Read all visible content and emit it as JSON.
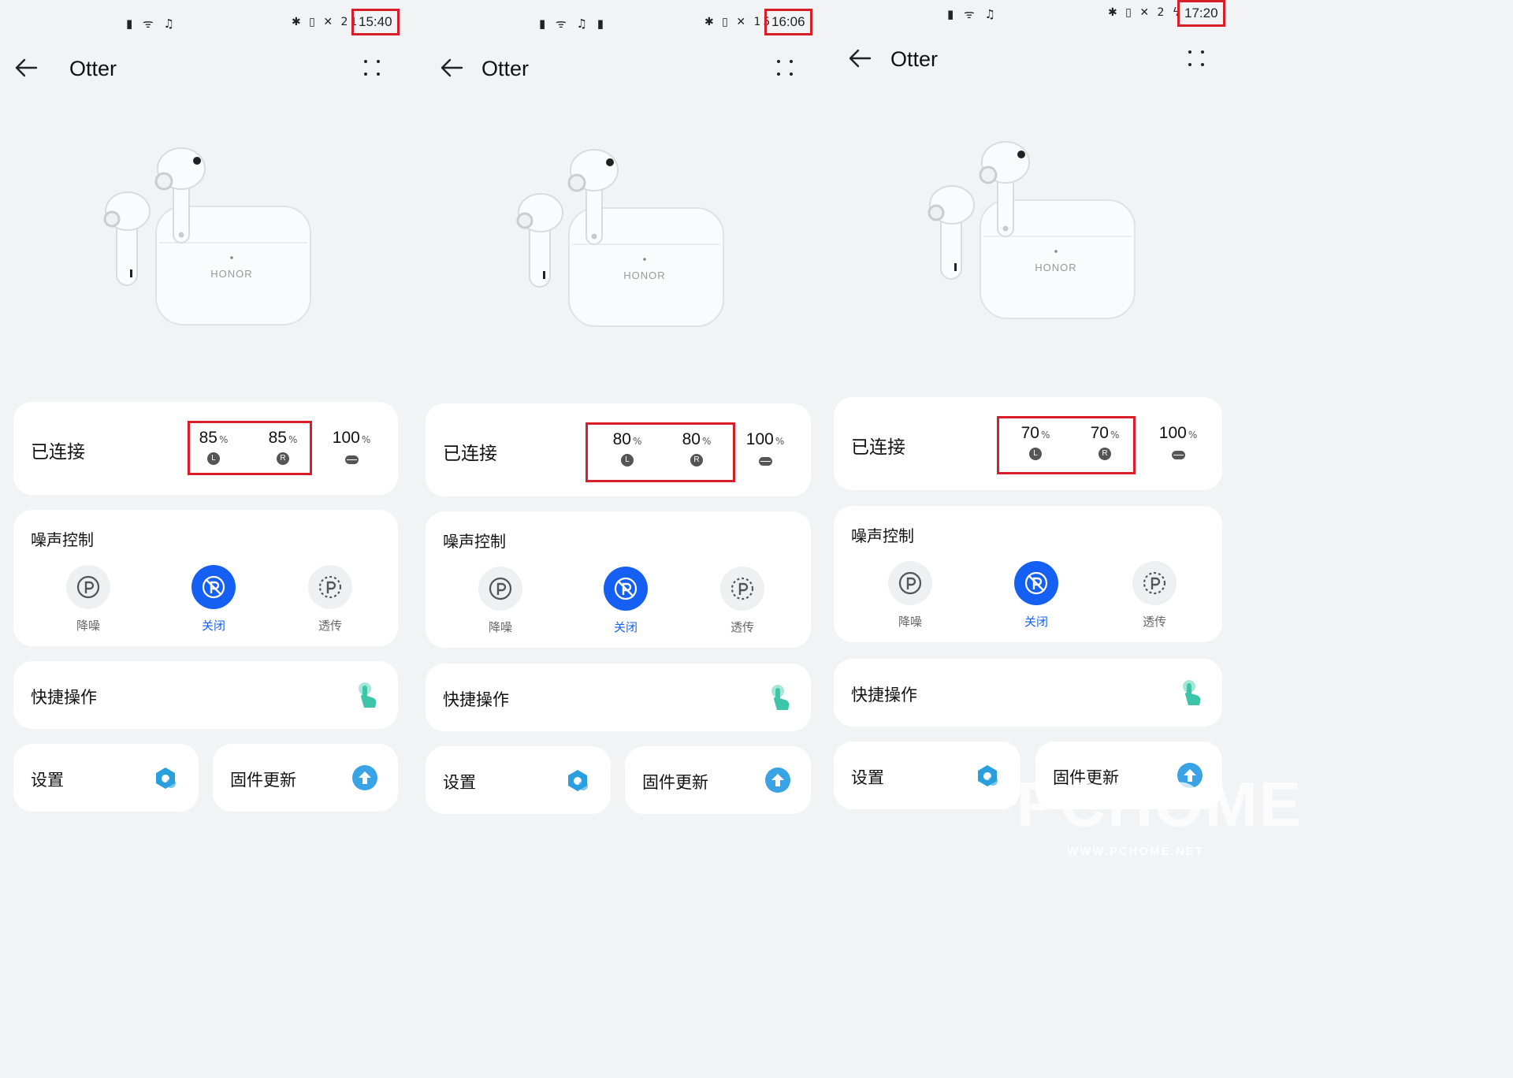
{
  "panels": [
    {
      "status": {
        "left_icons": "▮ ᯤ ♫",
        "right_icons": "✱ ▯ ✕ 21",
        "time": "15:40"
      },
      "app": {
        "title": "Otter",
        "back_icon": "arrow-left-icon",
        "more_icon": "more-dots-icon"
      },
      "product": {
        "brand": "HONOR"
      },
      "connection": {
        "label": "已连接",
        "left": "85",
        "right": "85",
        "case": "100",
        "unit": "%",
        "left_badge": "L",
        "right_badge": "R"
      },
      "noise": {
        "title": "噪声控制",
        "modes": [
          {
            "label": "降噪"
          },
          {
            "label": "关闭"
          },
          {
            "label": "透传"
          }
        ],
        "active": 1
      },
      "shortcuts": {
        "label": "快捷操作"
      },
      "settings": {
        "label": "设置"
      },
      "firmware": {
        "label": "固件更新"
      }
    },
    {
      "status": {
        "left_icons": "▮ ᯤ ♫ ▮",
        "right_icons": "✱ ▯ ✕ 15",
        "time": "16:06"
      },
      "app": {
        "title": "Otter",
        "back_icon": "arrow-left-icon",
        "more_icon": "more-dots-icon"
      },
      "product": {
        "brand": "HONOR"
      },
      "connection": {
        "label": "已连接",
        "left": "80",
        "right": "80",
        "case": "100",
        "unit": "%",
        "left_badge": "L",
        "right_badge": "R"
      },
      "noise": {
        "title": "噪声控制",
        "modes": [
          {
            "label": "降噪"
          },
          {
            "label": "关闭"
          },
          {
            "label": "透传"
          }
        ],
        "active": 1
      },
      "shortcuts": {
        "label": "快捷操作"
      },
      "settings": {
        "label": "设置"
      },
      "firmware": {
        "label": "固件更新"
      }
    },
    {
      "status": {
        "left_icons": "▮ ᯤ ♫",
        "right_icons": "✱ ▯ ✕ 2 ϟ",
        "time": "17:20"
      },
      "app": {
        "title": "Otter",
        "back_icon": "arrow-left-icon",
        "more_icon": "more-dots-icon"
      },
      "product": {
        "brand": "HONOR"
      },
      "connection": {
        "label": "已连接",
        "left": "70",
        "right": "70",
        "case": "100",
        "unit": "%",
        "left_badge": "L",
        "right_badge": "R"
      },
      "noise": {
        "title": "噪声控制",
        "modes": [
          {
            "label": "降噪"
          },
          {
            "label": "关闭"
          },
          {
            "label": "透传"
          }
        ],
        "active": 1
      },
      "shortcuts": {
        "label": "快捷操作"
      },
      "settings": {
        "label": "设置"
      },
      "firmware": {
        "label": "固件更新"
      }
    }
  ],
  "watermark": {
    "main": "PCHOME",
    "sub": "WWW.PCHOME.NET"
  },
  "colors": {
    "accent": "#1560f2",
    "highlight_box": "#d91e2a",
    "touch_icon": "#3cc5a8",
    "hex_icon": "#2a9fe0",
    "upload_icon": "#3aa3e6",
    "background": "#f1f3f5",
    "card": "#ffffff"
  }
}
